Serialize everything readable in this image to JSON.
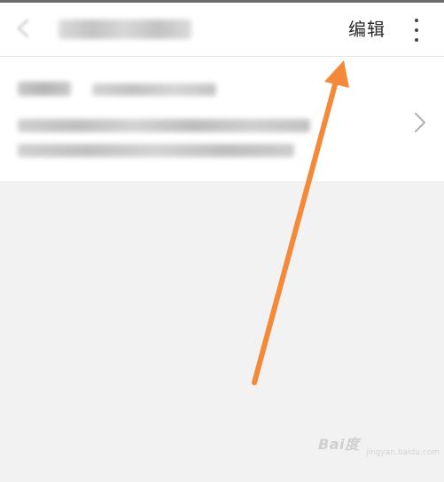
{
  "header": {
    "title": "",
    "edit_label": "编辑"
  },
  "address": {
    "name": "",
    "phone": "",
    "line1": "",
    "line2": ""
  },
  "icons": {
    "back": "back-arrow-icon",
    "more": "more-vertical-icon",
    "chevron": "chevron-right-icon",
    "annotation_arrow": "annotation-arrow-icon"
  },
  "colors": {
    "background": "#f2f2f2",
    "surface": "#ffffff",
    "annotation": "#f4893a",
    "text_primary": "#2a2a2a"
  },
  "watermark": {
    "brand": "Bai度",
    "sub": "jingyan.baidu.com"
  }
}
